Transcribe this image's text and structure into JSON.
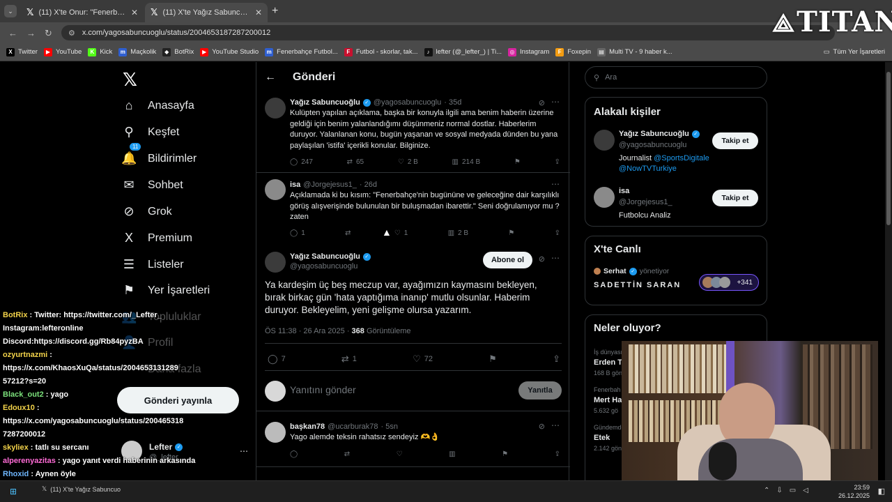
{
  "browser": {
    "tabs": [
      {
        "label": "(11) X'te Onur: \"Fenerbahçe'nin",
        "close": "✕"
      },
      {
        "label": "(11) X'te Yağız Sabuncuoğlu: \"(",
        "close": "✕"
      }
    ],
    "new_tab": "+",
    "url": "x.com/yagosabuncuoglu/status/2004653187287200012",
    "bookmarks": [
      {
        "label": "Twitter",
        "icon": "X",
        "color": "#000000"
      },
      {
        "label": "YouTube",
        "icon": "▶",
        "color": "#ff0000"
      },
      {
        "label": "Kick",
        "icon": "K",
        "color": "#53fc18"
      },
      {
        "label": "Maçkolik",
        "icon": "m",
        "color": "#2f5fd0"
      },
      {
        "label": "BotRix",
        "icon": "◆",
        "color": "#222222"
      },
      {
        "label": "YouTube Studio",
        "icon": "▶",
        "color": "#ff0000"
      },
      {
        "label": "Fenerbahçe Futbol...",
        "icon": "m",
        "color": "#2f5fd0"
      },
      {
        "label": "Futbol - skorlar, tak...",
        "icon": "F",
        "color": "#c8102e"
      },
      {
        "label": "lefter (@_lefter_) | Ti...",
        "icon": "♪",
        "color": "#111111"
      },
      {
        "label": "Instagram",
        "icon": "◎",
        "color": "#d6249f"
      },
      {
        "label": "Foxepin",
        "icon": "F",
        "color": "#f39c12"
      },
      {
        "label": "Multi TV - 9 haber k...",
        "icon": "▤",
        "color": "#666666"
      }
    ],
    "bookmarks_all": "Tüm Yer İşaretleri"
  },
  "watermark": {
    "text": "TITAN"
  },
  "nav": {
    "items": [
      {
        "label": "Anasayfa",
        "icon": "⌂"
      },
      {
        "label": "Keşfet",
        "icon": "⚲"
      },
      {
        "label": "Bildirimler",
        "icon": "🔔",
        "badge": "11"
      },
      {
        "label": "Sohbet",
        "icon": "✉"
      },
      {
        "label": "Grok",
        "icon": "⊘"
      },
      {
        "label": "Premium",
        "icon": "X"
      },
      {
        "label": "Listeler",
        "icon": "☰"
      },
      {
        "label": "Yer İşaretleri",
        "icon": "⚑"
      },
      {
        "label": "Topluluklar",
        "icon": "👥"
      },
      {
        "label": "Profil",
        "icon": "👤"
      },
      {
        "label": "Daha fazla",
        "icon": "⋯"
      }
    ],
    "post_button": "Gönderi yayınla",
    "account": {
      "name": "Lefter",
      "handle": "@_lefter_"
    }
  },
  "post": {
    "header_title": "Gönderi",
    "parent_tweet": {
      "name": "Yağız Sabuncuoğlu",
      "handle": "@yagosabuncuoglu",
      "time": "· 35d",
      "text": "Kulüpten yapılan açıklama, başka bir konuyla ilgili ama benim haberin üzerine geldiği için benim yalanlandığımı düşünmeniz normal dostlar. Haberlerim duruyor. Yalanlanan konu, bugün yaşanan ve sosyal medyada dünden bu yana paylaşılan 'istifa' içerikli konular. Bilginize.",
      "replies": "247",
      "reposts": "65",
      "likes": "2 B",
      "views": "214 B"
    },
    "reply_tweet": {
      "name": "isa",
      "handle": "@Jorgejesus1_",
      "time": "· 26d",
      "text": "Açıklamada ki bu kısım: \"Fenerbahçe'nin bugününe ve geleceğine dair karşılıklı görüş alışverişinde bulunulan bir buluşmadan ibarettir.\" Seni doğrulamıyor mu ? zaten",
      "replies": "1",
      "reposts": "",
      "likes": "1",
      "views": "2 B"
    },
    "main_tweet": {
      "name": "Yağız Sabuncuoğlu",
      "handle": "@yagosabuncuoglu",
      "subscribe": "Abone ol",
      "text": "Ya kardeşim üç beş meczup var, ayağımızın kaymasını bekleyen, bırak birkaç gün 'hata yaptığıma inanıp' mutlu olsunlar. Haberim duruyor. Bekleyelim, yeni gelişme olursa yazarım.",
      "time": "ÖS 11:38 · 26 Ara 2025 · ",
      "views": "368",
      "views_label": " Görüntüleme",
      "replies": "7",
      "reposts": "1",
      "likes": "72"
    },
    "reply_box": {
      "placeholder": "Yanıtını gönder",
      "button": "Yanıtla"
    },
    "comment": {
      "name": "başkan78",
      "handle": "@ucarburak78",
      "time": "· 5sn",
      "text": "Yago alemde teksin rahatsız sendeyiz 🫶👌"
    }
  },
  "sidebar": {
    "search_placeholder": "Ara",
    "related_title": "Alakalı kişiler",
    "people": [
      {
        "name": "Yağız Sabuncuoğlu",
        "handle": "@yagosabuncuoglu",
        "bio": "Journalist ",
        "links": "@SportsDigitale",
        "link2": "@NowTVTurkiye",
        "follow": "Takip et"
      },
      {
        "name": "isa",
        "handle": "@Jorgejesus1_",
        "bio": "Futbolcu Analiz",
        "follow": "Takip et"
      }
    ],
    "live_title": "X'te Canlı",
    "live": {
      "host": "Serhat",
      "role": "yönetiyor",
      "space": "SADETTİN SARAN",
      "count": "+341"
    },
    "trends_title": "Neler oluyor?",
    "trends": [
      {
        "category": "İş dünyası",
        "name": "Erden T",
        "count": "168 B gön"
      },
      {
        "category": "Fenerbah",
        "name": "Mert Ha",
        "count": "5.632 gö"
      },
      {
        "category": "Gündemde",
        "name": "Etek",
        "count": "2.142 gön"
      }
    ]
  },
  "chat": [
    {
      "nick": "BotRix",
      "text": " : Twitter: https://twitter.com/_Lefter_ Instagram:lefteronline Discord:https://discord.gg/Rb84pyzBA",
      "nick_color": "#f3d34a"
    },
    {
      "nick": "ozyurtnazmi",
      "text": " : https://x.com/KhaosXuQa/status/2004653131289 57212?s=20",
      "nick_color": "#f3d34a"
    },
    {
      "nick": "Black_out2",
      "text": " : yago",
      "nick_color": "#7be07b"
    },
    {
      "nick": "Edoux10",
      "text": " : https://x.com/yagosabuncuoglu/status/200465318 7287200012",
      "nick_color": "#f3d34a"
    },
    {
      "nick": "skyliex",
      "text": " : tatlı su sercanı",
      "nick_color": "#f3d34a"
    },
    {
      "nick": "alperenyazitas",
      "text": " : yago yanıt verdi haberinin arkasında",
      "nick_color": "#ff6bd6"
    },
    {
      "nick": "Rhoxid",
      "text": " : Aynen öyle",
      "nick_color": "#6fb7ff"
    }
  ],
  "taskbar": {
    "item": "(11) X'te Yağız Sabuncuo",
    "time": "23:59",
    "date": "26.12.2025"
  }
}
